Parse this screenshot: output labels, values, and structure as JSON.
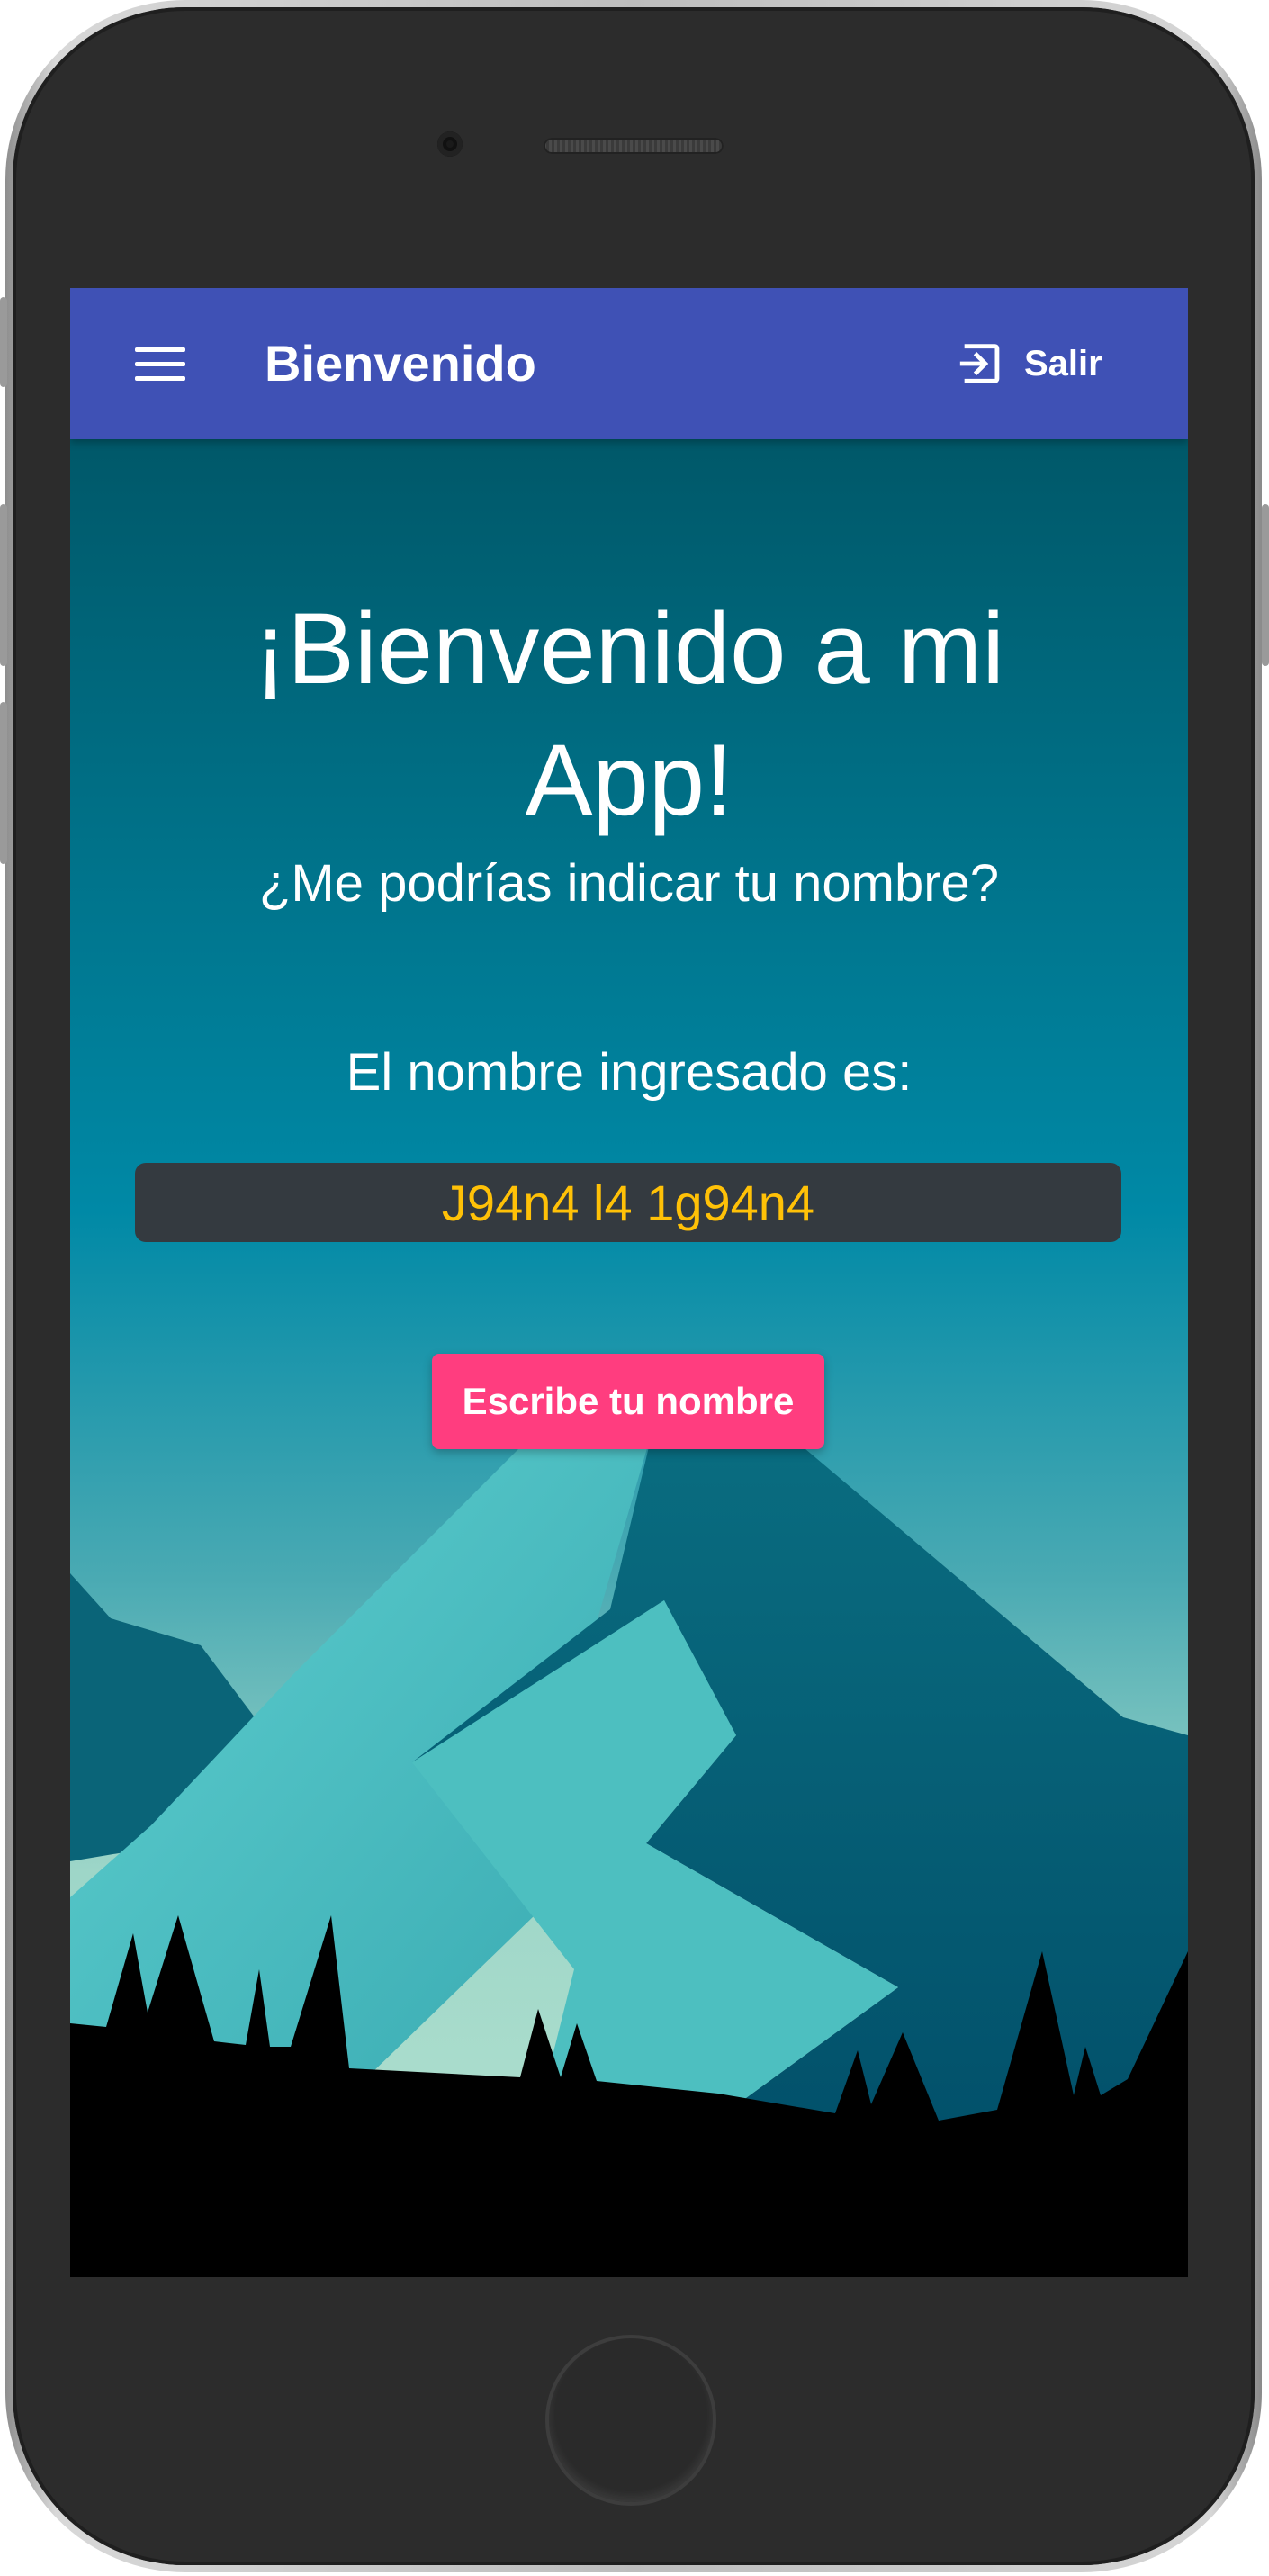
{
  "app_bar": {
    "title": "Bienvenido",
    "logout_label": "Salir",
    "background": "#3f51b5"
  },
  "main": {
    "headline": "¡Bienvenido a mi App!",
    "subtitle": "¿Me podrías indicar tu nombre?",
    "result_label": "El nombre ingresado es:",
    "result_value": "J94n4 l4 1g94n4",
    "button_label": "Escribe tu nombre"
  },
  "colors": {
    "accent_button": "#ff3d7f",
    "result_text": "#ffc107",
    "result_box": "#343a40"
  },
  "icons": {
    "menu": "menu-icon",
    "logout": "logout-icon"
  }
}
